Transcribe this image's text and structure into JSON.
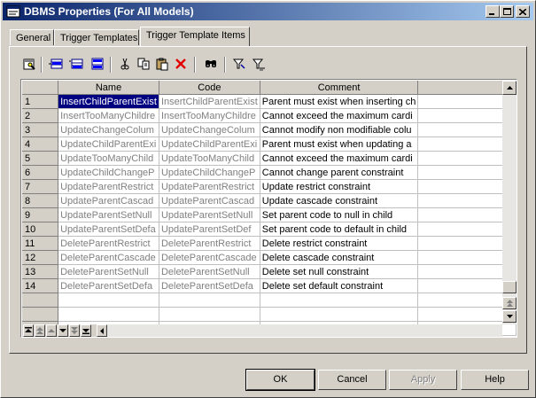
{
  "window": {
    "title": "DBMS Properties (For All Models)"
  },
  "tabs": [
    {
      "label": "General"
    },
    {
      "label": "Trigger Templates"
    },
    {
      "label": "Trigger Template Items"
    }
  ],
  "grid": {
    "columns": [
      "Name",
      "Code",
      "Comment"
    ],
    "rows": [
      {
        "num": "1",
        "name": "InsertChildParentExist",
        "code": "InsertChildParentExist",
        "comment": "Parent must exist when inserting ch"
      },
      {
        "num": "2",
        "name": "InsertTooManyChildre",
        "code": "InsertTooManyChildre",
        "comment": "Cannot exceed the maximum cardi"
      },
      {
        "num": "3",
        "name": "UpdateChangeColum",
        "code": "UpdateChangeColum",
        "comment": "Cannot modify non modifiable colu"
      },
      {
        "num": "4",
        "name": "UpdateChildParentExi",
        "code": "UpdateChildParentExi",
        "comment": "Parent must exist when updating a"
      },
      {
        "num": "5",
        "name": "UpdateTooManyChild",
        "code": "UpdateTooManyChild",
        "comment": "Cannot exceed the maximum cardi"
      },
      {
        "num": "6",
        "name": "UpdateChildChangeP",
        "code": "UpdateChildChangeP",
        "comment": "Cannot change parent constraint"
      },
      {
        "num": "7",
        "name": "UpdateParentRestrict",
        "code": "UpdateParentRestrict",
        "comment": "Update restrict constraint"
      },
      {
        "num": "8",
        "name": "UpdateParentCascad",
        "code": "UpdateParentCascad",
        "comment": "Update cascade constraint"
      },
      {
        "num": "9",
        "name": "UpdateParentSetNull",
        "code": "UpdateParentSetNull",
        "comment": "Set parent code to null in child"
      },
      {
        "num": "10",
        "name": "UpdateParentSetDefa",
        "code": "UpdateParentSetDef",
        "comment": "Set parent code to default in child"
      },
      {
        "num": "11",
        "name": "DeleteParentRestrict",
        "code": "DeleteParentRestrict",
        "comment": "Delete restrict constraint"
      },
      {
        "num": "12",
        "name": "DeleteParentCascade",
        "code": "DeleteParentCascade",
        "comment": "Delete cascade constraint"
      },
      {
        "num": "13",
        "name": "DeleteParentSetNull",
        "code": "DeleteParentSetNull",
        "comment": "Delete set null constraint"
      },
      {
        "num": "14",
        "name": "DeleteParentSetDefa",
        "code": "DeleteParentSetDefa",
        "comment": "Delete set default constraint"
      }
    ]
  },
  "buttons": {
    "ok": "OK",
    "cancel": "Cancel",
    "apply": "Apply",
    "help": "Help"
  },
  "icons": {
    "toolbar": [
      "properties-icon",
      "add-row-icon",
      "insert-row-icon",
      "add-rows-icon",
      "cut-icon",
      "copy-icon",
      "paste-icon",
      "delete-icon",
      "find-icon",
      "filter-icon",
      "clear-filter-icon"
    ]
  },
  "colors": {
    "titlebar": "#0a246a",
    "selection": "#000080",
    "face": "#d4d0c8"
  }
}
